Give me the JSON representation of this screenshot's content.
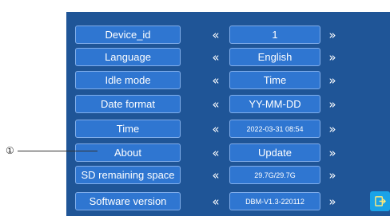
{
  "rows": [
    {
      "label": "Device_id",
      "value": "1",
      "left_arrow": "«",
      "right_arrow": "»"
    },
    {
      "label": "Language",
      "value": "English",
      "left_arrow": "«",
      "right_arrow": "»"
    },
    {
      "label": "Idle mode",
      "value": "Time",
      "left_arrow": "«",
      "right_arrow": "»"
    },
    {
      "label": "Date format",
      "value": "YY-MM-DD",
      "left_arrow": "«",
      "right_arrow": "»"
    },
    {
      "label": "Time",
      "value": "2022-03-31 08:54",
      "left_arrow": "«",
      "right_arrow": "»"
    },
    {
      "label": "About",
      "value": "Update",
      "left_arrow": "«",
      "right_arrow": "»"
    },
    {
      "label": "SD remaining space",
      "value": "29.7G/29.7G",
      "left_arrow": "«",
      "right_arrow": "»"
    },
    {
      "label": "Software version",
      "value": "DBM-V1.3-220112",
      "left_arrow": "«",
      "right_arrow": "»"
    }
  ],
  "callout": {
    "number": "①"
  },
  "corner_button": {
    "icon": "exit-icon"
  },
  "colors": {
    "panel": "#1f5597",
    "box": "#2f76d1",
    "accent": "#1aa3e8"
  }
}
